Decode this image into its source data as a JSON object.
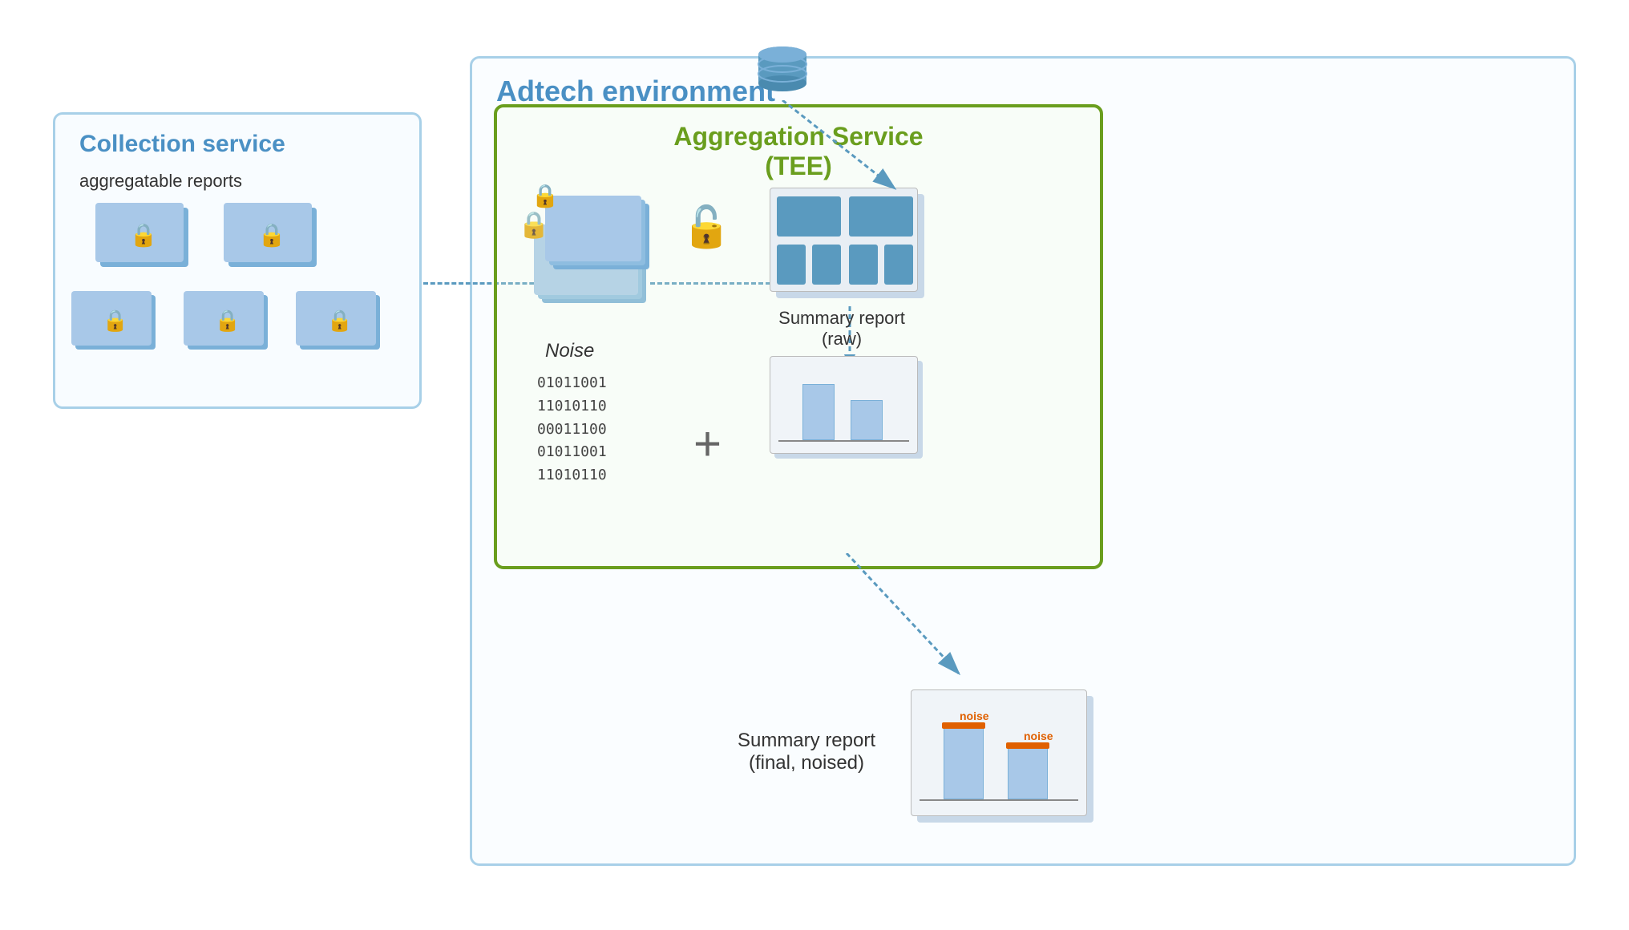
{
  "diagram": {
    "adtech_env": {
      "label": "Adtech environment"
    },
    "collection_service": {
      "label": "Collection service",
      "sublabel": "aggregatable reports"
    },
    "aggregation_service": {
      "label": "Aggregation Service",
      "label2": "(TEE)"
    },
    "noise": {
      "label": "Noise",
      "binary": [
        "01011001",
        "11010110",
        "00011100",
        "01011001",
        "11010110"
      ]
    },
    "summary_raw": {
      "label": "Summary report",
      "label2": "(raw)"
    },
    "summary_final": {
      "label": "Summary report",
      "label2": "(final, noised)"
    },
    "noise_bar1": "noise",
    "noise_bar2": "noise"
  }
}
